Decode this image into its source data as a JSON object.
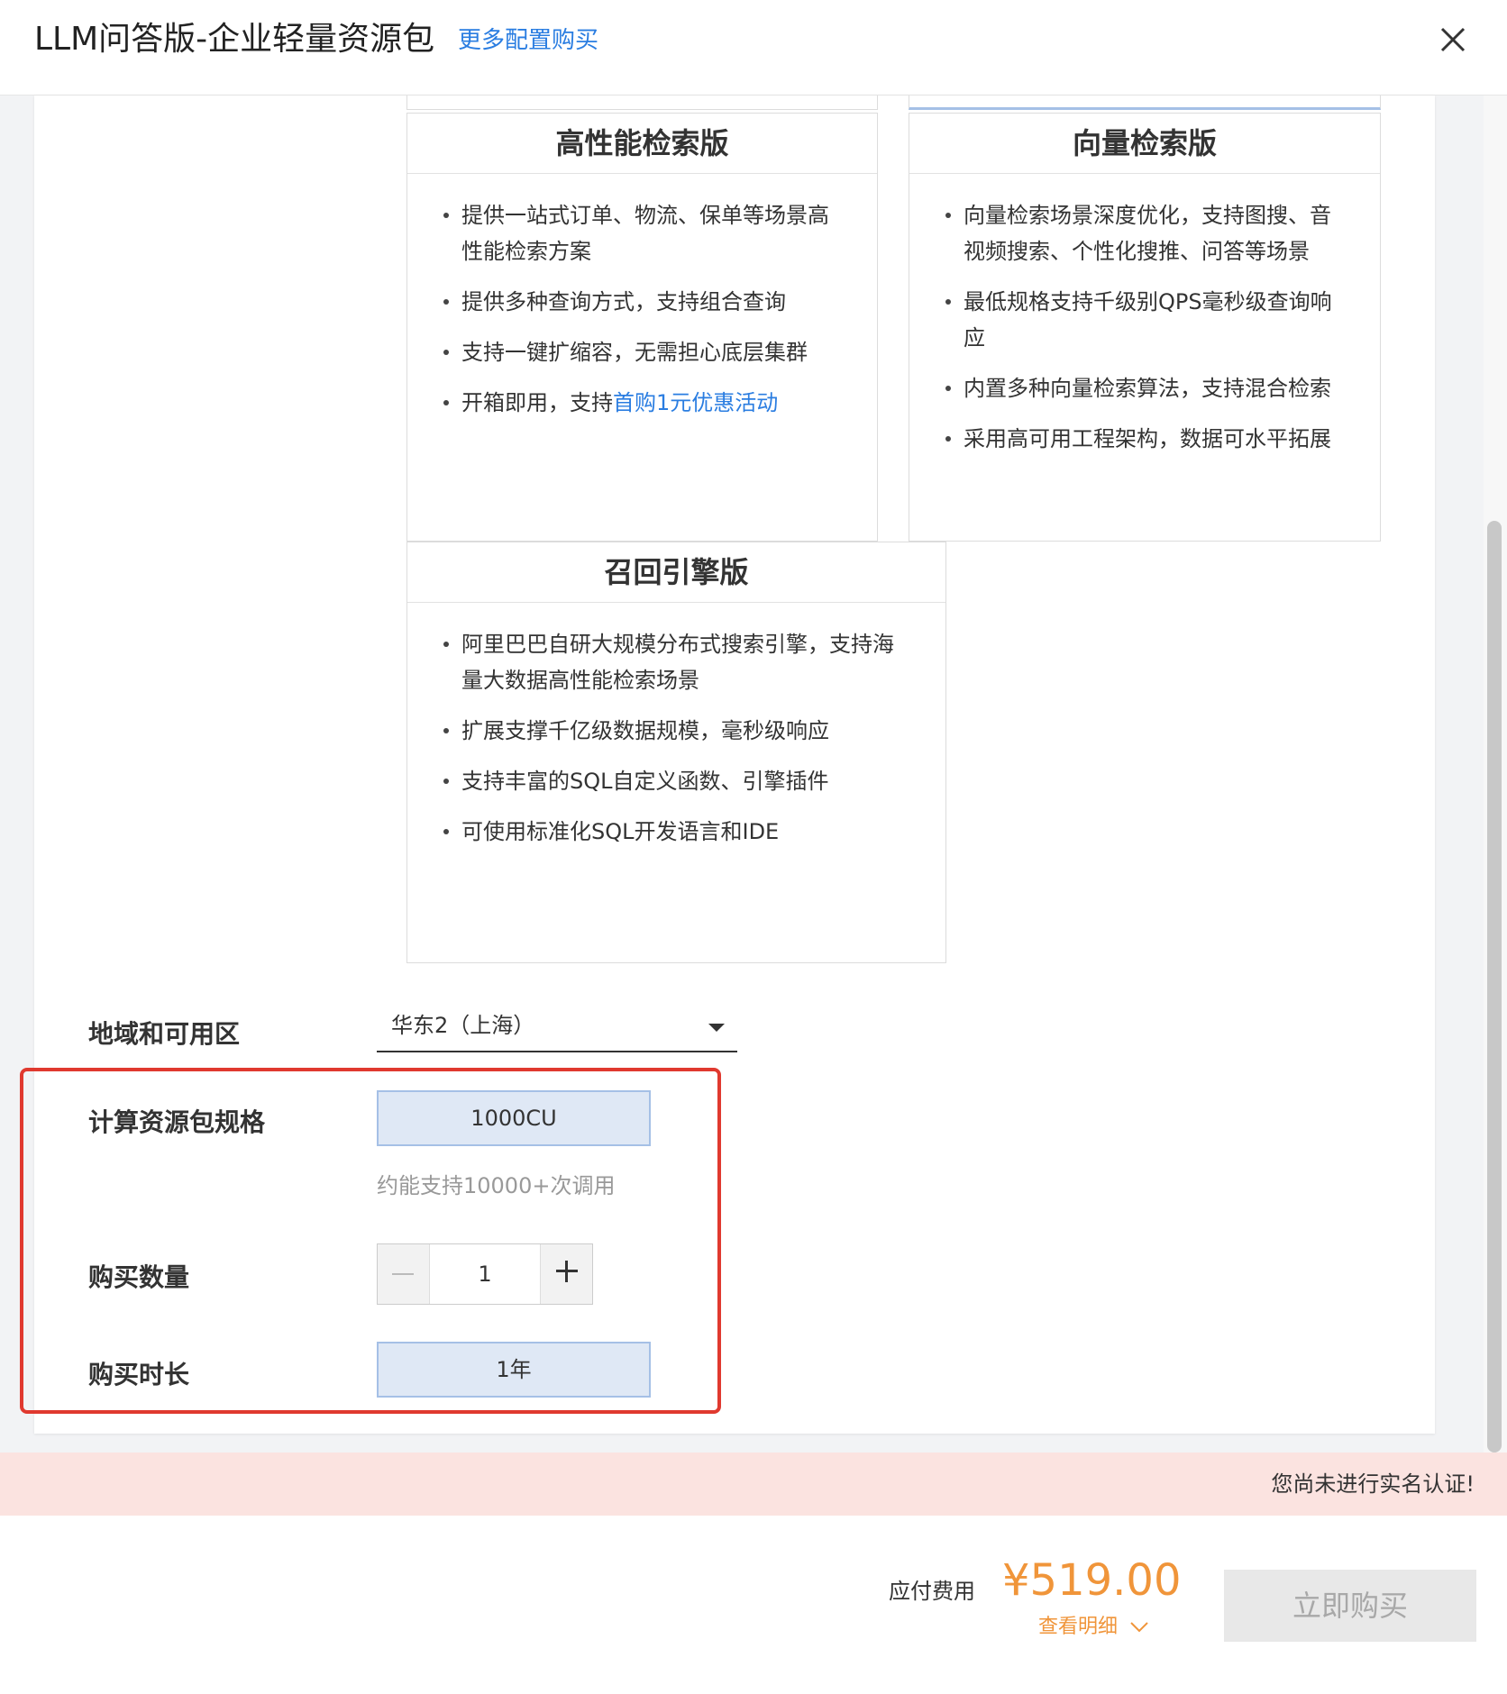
{
  "header": {
    "title": "LLM问答版-企业轻量资源包",
    "more_link": "更多配置购买"
  },
  "cards": [
    {
      "title": "高性能检索版",
      "items": [
        "提供一站式订单、物流、保单等场景高性能检索方案",
        "提供多种查询方式，支持组合查询",
        "支持一键扩缩容，无需担心底层集群"
      ],
      "last_item_prefix": "开箱即用，支持",
      "last_item_link": "首购1元优惠活动"
    },
    {
      "title": "向量检索版",
      "items": [
        "向量检索场景深度优化，支持图搜、音视频搜索、个性化搜推、问答等场景",
        "最低规格支持千级别QPS毫秒级查询响应",
        "内置多种向量检索算法，支持混合检索",
        "采用高可用工程架构，数据可水平拓展"
      ]
    },
    {
      "title": "召回引擎版",
      "items": [
        "阿里巴巴自研大规模分布式搜索引擎，支持海量大数据高性能检索场景",
        "扩展支撑千亿级数据规模，毫秒级响应",
        "支持丰富的SQL自定义函数、引擎插件",
        "可使用标准化SQL开发语言和IDE"
      ]
    }
  ],
  "form": {
    "region_label": "地域和可用区",
    "region_value": "华东2（上海）",
    "spec_label": "计算资源包规格",
    "spec_value": "1000CU",
    "spec_hint": "约能支持10000+次调用",
    "quantity_label": "购买数量",
    "quantity_value": "1",
    "duration_label": "购买时长",
    "duration_value": "1年"
  },
  "warning": {
    "text": "您尚未进行实名认证!"
  },
  "footer": {
    "fee_label": "应付费用",
    "fee_amount": "¥519.00",
    "detail_link": "查看明细",
    "buy_button": "立即购买"
  },
  "colors": {
    "accent_link": "#2a7de1",
    "price": "#f0953a",
    "highlight_border": "#e0392f",
    "warning_bg": "#fbe3e0",
    "selected_option_bg": "#dfe8f5"
  },
  "icons": {
    "close": "close-icon",
    "dropdown": "caret-down-icon",
    "detail": "chevron-down-icon"
  }
}
